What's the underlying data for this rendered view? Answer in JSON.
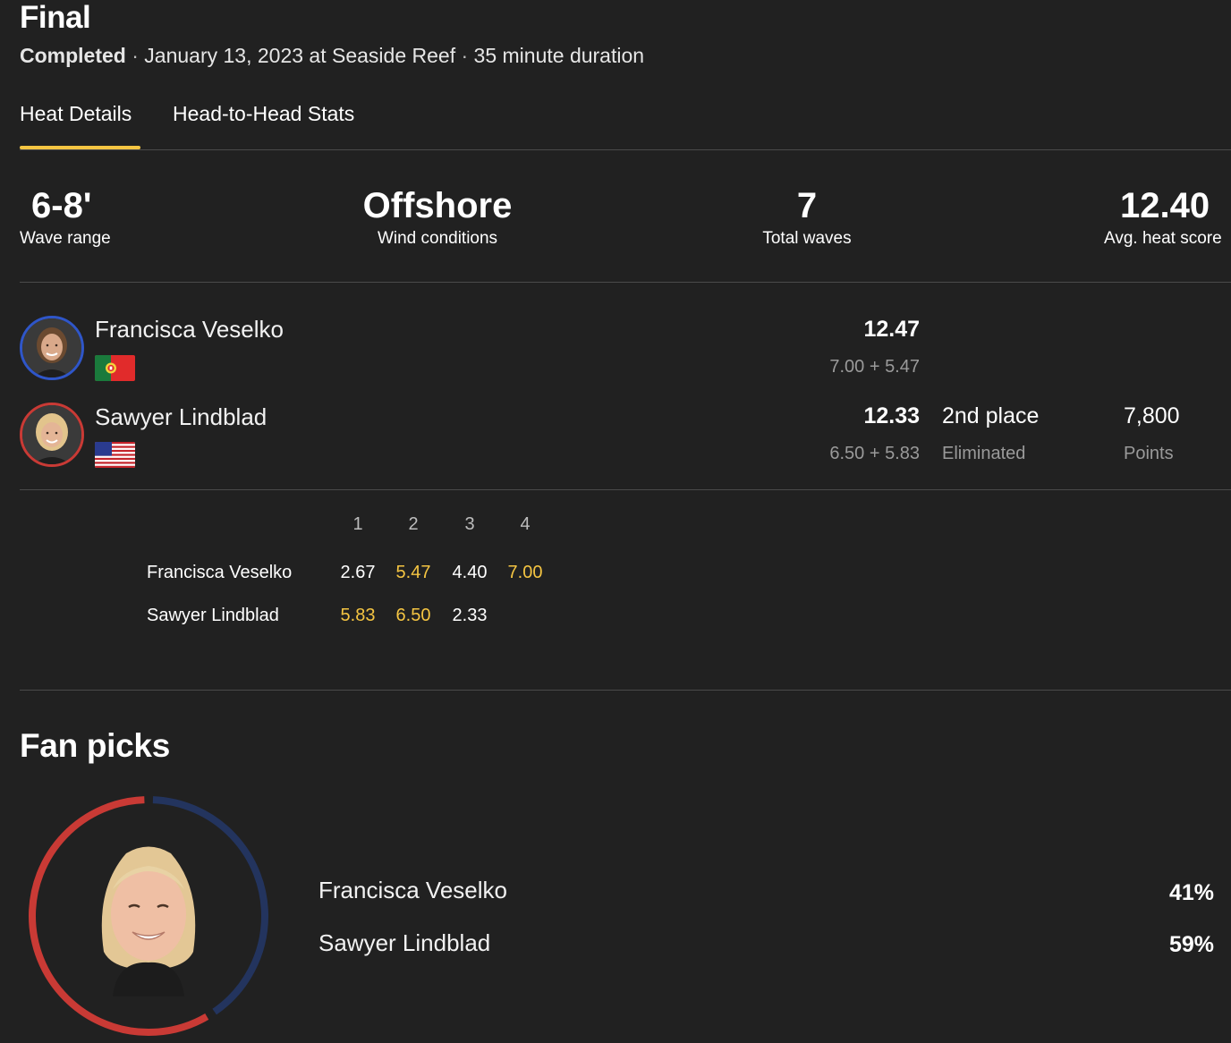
{
  "header": {
    "title": "Final",
    "status": "Completed",
    "sep1": " · ",
    "date_location": "January 13, 2023 at Seaside Reef",
    "sep2": " · ",
    "duration": "35 minute duration"
  },
  "tabs": [
    {
      "label": "Heat Details",
      "active": true
    },
    {
      "label": "Head-to-Head Stats",
      "active": false
    }
  ],
  "stats": [
    {
      "value": "6-8'",
      "label": "Wave range"
    },
    {
      "value": "Offshore",
      "label": "Wind conditions"
    },
    {
      "value": "7",
      "label": "Total waves"
    },
    {
      "value": "12.40",
      "label": "Avg. heat score"
    }
  ],
  "surfers": [
    {
      "name": "Francisca Veselko",
      "country_flag": "portugal-flag",
      "ring_color": "#2f56c9",
      "total": "12.47",
      "breakdown": "7.00 + 5.47"
    },
    {
      "name": "Sawyer Lindblad",
      "country_flag": "usa-flag",
      "ring_color": "#c93a35",
      "total": "12.33",
      "breakdown": "6.50 + 5.83",
      "place": "2nd place",
      "place_status": "Eliminated",
      "points": "7,800",
      "points_label": "Points"
    }
  ],
  "waves": {
    "columns": [
      "1",
      "2",
      "3",
      "4"
    ],
    "rows": [
      {
        "name": "Francisca Veselko",
        "scores": [
          "2.67",
          "5.47",
          "4.40",
          "7.00"
        ],
        "highlight": [
          false,
          true,
          false,
          true
        ]
      },
      {
        "name": "Sawyer Lindblad",
        "scores": [
          "5.83",
          "6.50",
          "2.33"
        ],
        "highlight": [
          true,
          true,
          false
        ]
      }
    ]
  },
  "fan_picks": {
    "title": "Fan picks",
    "entries": [
      {
        "name": "Francisca Veselko",
        "percent": "41%",
        "share": 0.41,
        "color": "#23345e"
      },
      {
        "name": "Sawyer Lindblad",
        "percent": "59%",
        "share": 0.59,
        "color": "#c93a35"
      }
    ]
  },
  "colors": {
    "background": "#212121",
    "accent": "#f5c542",
    "divider": "#4a4a4a",
    "muted_text": "#9a9a9a"
  }
}
